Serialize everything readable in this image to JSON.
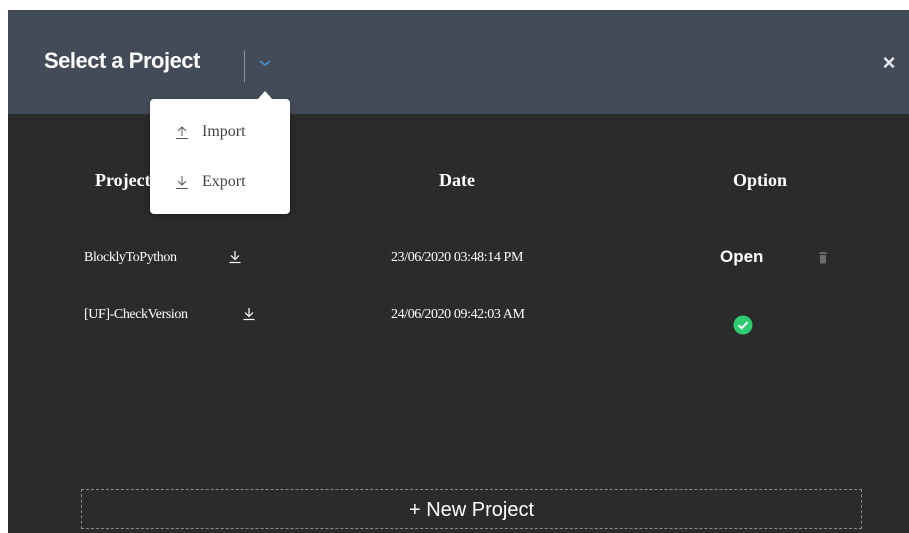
{
  "header": {
    "title": "Select a Project",
    "close_label": "×"
  },
  "menu": {
    "items": [
      {
        "label": "Import",
        "icon": "upload-icon"
      },
      {
        "label": "Export",
        "icon": "download-icon"
      }
    ]
  },
  "table": {
    "columns": [
      "Project",
      "Date",
      "Option"
    ],
    "rows": [
      {
        "name": "BlocklyToPython",
        "date": "23/06/2020 03:48:14 PM",
        "option": "Open",
        "option_icon": "trash-icon"
      },
      {
        "name": "[UF]-CheckVersion",
        "date": "24/06/2020 09:42:03 AM",
        "option": "",
        "option_icon": "check-circle-icon"
      }
    ]
  },
  "footer": {
    "new_project_label": "+ New Project"
  },
  "colors": {
    "header_bg": "#424b57",
    "body_bg": "#2b2b2b",
    "accent": "#4a90d9",
    "success": "#2ecc71"
  }
}
